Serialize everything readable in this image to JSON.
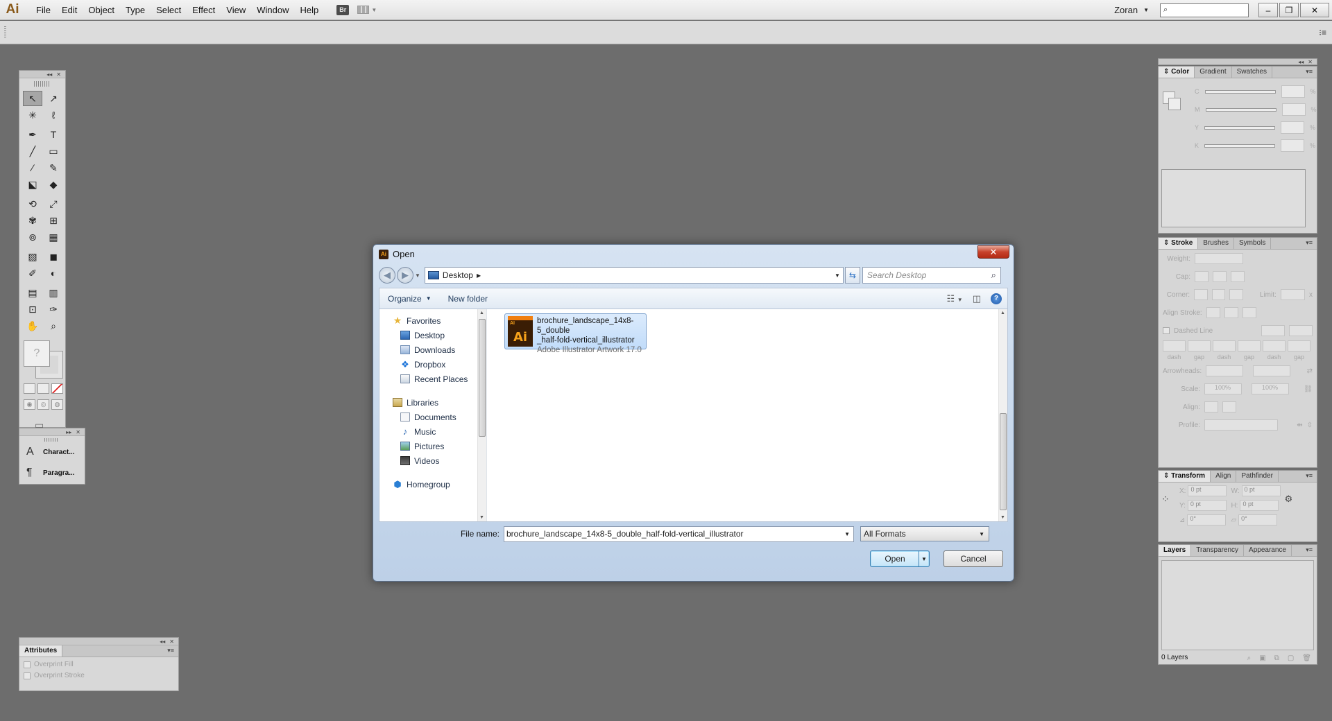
{
  "menubar": {
    "app_logo": "Ai",
    "items": [
      "File",
      "Edit",
      "Object",
      "Type",
      "Select",
      "Effect",
      "View",
      "Window",
      "Help"
    ],
    "bridge": "Br",
    "user": "Zoran",
    "window_buttons": [
      "–",
      "❐",
      "✕"
    ]
  },
  "tools": [
    "↖",
    "↗",
    "✳",
    "ℓ",
    "✒",
    "T",
    "╱",
    "▭",
    "∕",
    "✎",
    "⬕",
    "◆",
    "⟲",
    "⤢",
    "✾",
    "⊞",
    "⊚",
    "▦",
    "▧",
    "◼",
    "✐",
    "◐",
    "▤",
    "▥",
    "⊡",
    "✑",
    "✋",
    "⌕"
  ],
  "charpara": {
    "items": [
      {
        "icon": "A",
        "label": "Charact..."
      },
      {
        "icon": "¶",
        "label": "Paragra..."
      }
    ]
  },
  "attributes": {
    "tab": "Attributes",
    "options": [
      "Overprint Fill",
      "Overprint Stroke"
    ]
  },
  "color_panel": {
    "tabs": [
      "Color",
      "Gradient",
      "Swatches"
    ],
    "channels": [
      "C",
      "M",
      "Y",
      "K"
    ],
    "unit": "%"
  },
  "stroke_panel": {
    "tabs": [
      "Stroke",
      "Brushes",
      "Symbols"
    ],
    "weight": "Weight:",
    "cap": "Cap:",
    "corner": "Corner:",
    "limit": "Limit:",
    "limit_unit": "x",
    "align_stroke": "Align Stroke:",
    "dashed_line": "Dashed Line",
    "dash_labels": [
      "dash",
      "gap",
      "dash",
      "gap",
      "dash",
      "gap"
    ],
    "arrowheads": "Arrowheads:",
    "scale": "Scale:",
    "scale_values": [
      "100%",
      "100%"
    ],
    "align": "Align:",
    "profile": "Profile:"
  },
  "transform_panel": {
    "tabs": [
      "Transform",
      "Align",
      "Pathfinder"
    ],
    "x": "X:",
    "y": "Y:",
    "w": "W:",
    "h": "H:",
    "x_val": "0 pt",
    "y_val": "0 pt",
    "w_val": "0 pt",
    "h_val": "0 pt",
    "rot_val": "0°",
    "shear_val": "0°"
  },
  "layers_panel": {
    "tabs": [
      "Layers",
      "Transparency",
      "Appearance"
    ],
    "count": "0 Layers"
  },
  "dialog": {
    "title": "Open",
    "address": "Desktop",
    "search_placeholder": "Search Desktop",
    "toolbar": {
      "organize": "Organize",
      "new_folder": "New folder"
    },
    "nav": {
      "favorites": "Favorites",
      "favorites_items": [
        "Desktop",
        "Downloads",
        "Dropbox",
        "Recent Places"
      ],
      "libraries": "Libraries",
      "libraries_items": [
        "Documents",
        "Music",
        "Pictures",
        "Videos"
      ],
      "homegroup": "Homegroup"
    },
    "file": {
      "name_line1": "brochure_landscape_14x8-5_double",
      "name_line2": "_half-fold-vertical_illustrator",
      "type": "Adobe Illustrator Artwork 17.0",
      "icon_label": "Ai",
      "icon_tag": "AI"
    },
    "file_name_label": "File name:",
    "file_name_value": "brochure_landscape_14x8-5_double_half-fold-vertical_illustrator",
    "format": "All Formats",
    "open_button": "Open",
    "cancel_button": "Cancel"
  }
}
